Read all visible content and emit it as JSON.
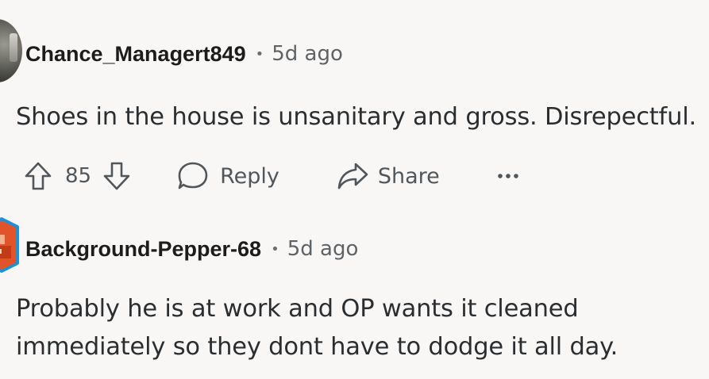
{
  "comments": [
    {
      "username": "Chance_Managert849",
      "separator": "•",
      "time": "5d ago",
      "body": [
        "Shoes in the house is unsanitary and gross. Disrepectful."
      ],
      "score": "85",
      "actions": {
        "reply": "Reply",
        "share": "Share"
      },
      "icons": [
        "upvote-icon",
        "downvote-icon",
        "reply-bubble-icon",
        "share-arrow-icon",
        "more-options-icon"
      ]
    },
    {
      "username": "Background-Pepper-68",
      "separator": "•",
      "time": "5d ago",
      "body": [
        "Probably he is at work and OP wants it cleaned",
        "immediately so they dont have to dodge it all day."
      ]
    }
  ],
  "colors": {
    "background": "#f8f7f5",
    "text": "#2b2e31",
    "muted": "#5f6367",
    "avatar_hex_border": "#1f8fd6",
    "avatar_hex_fill": "#e1542a"
  }
}
